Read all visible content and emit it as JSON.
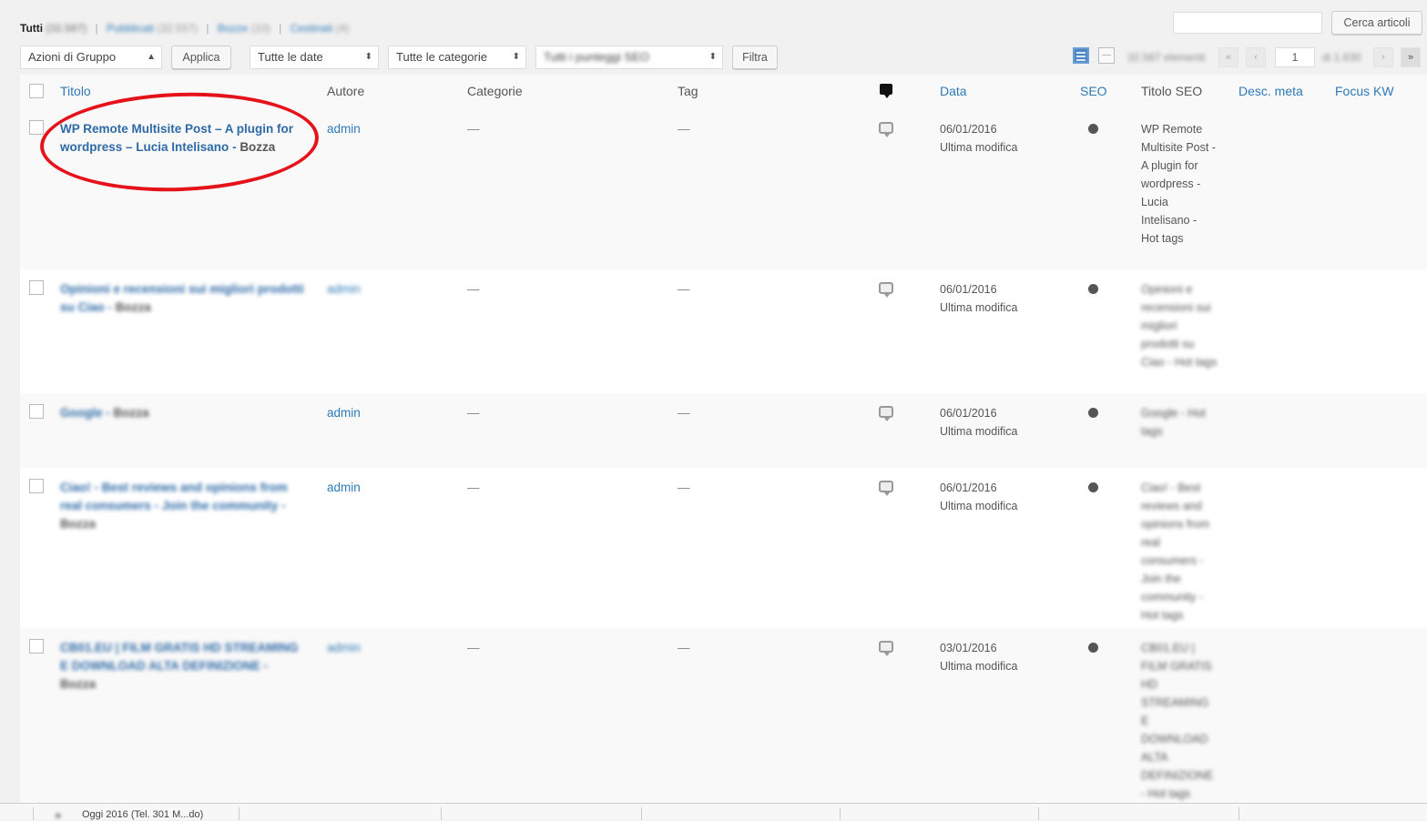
{
  "status_links": [
    {
      "label": "Tutti",
      "count": "(32.587)",
      "current": true
    },
    {
      "label": "Pubblicati",
      "count": "(32.557)",
      "current": false
    },
    {
      "label": "Bozze",
      "count": "(10)",
      "current": false
    },
    {
      "label": "Cestinati",
      "count": "(4)",
      "current": false
    }
  ],
  "search": {
    "button_label": "Cerca articoli",
    "value": ""
  },
  "toolbar": {
    "bulk_actions": "Azioni di Gruppo",
    "apply_label": "Applica",
    "date_filter": "Tutte le date",
    "category_filter": "Tutte le categorie",
    "seo_filter": "Tutti i punteggi SEO",
    "filter_label": "Filtra"
  },
  "pagination": {
    "items_count": "32.587 elementi",
    "first": "«",
    "prev": "‹",
    "current_page": "1",
    "total": "di 1.630",
    "next": "›",
    "last": "»"
  },
  "columns": {
    "title": "Titolo",
    "author": "Autore",
    "categories": "Categorie",
    "tags": "Tag",
    "date": "Data",
    "seo": "SEO",
    "seo_title": "Titolo SEO",
    "meta_desc": "Desc. meta",
    "focus_kw": "Focus KW"
  },
  "rows": [
    {
      "title": "WP Remote Multisite Post – A plugin for wordpress – Lucia Intelisano",
      "state": "Bozza",
      "author": "admin",
      "categories": "—",
      "tags": "—",
      "date": "06/01/2016",
      "date_note": "Ultima modifica",
      "seo_title": "WP Remote Multisite Post - A plugin for wordpress - Lucia Intelisano - Hot tags",
      "blurred": false
    },
    {
      "title": "Opinioni e recensioni sui migliori prodotti su Ciao",
      "state": "Bozza",
      "author": "admin",
      "categories": "—",
      "tags": "—",
      "date": "06/01/2016",
      "date_note": "Ultima modifica",
      "seo_title": "Opinioni e recensioni sui migliori prodotti su Ciao - Hot tags",
      "blurred": true
    },
    {
      "title": "Google",
      "state": "Bozza",
      "author": "admin",
      "categories": "—",
      "tags": "—",
      "date": "06/01/2016",
      "date_note": "Ultima modifica",
      "seo_title": "Google - Hot tags",
      "blurred": true
    },
    {
      "title": "Ciao! - Best reviews and opinions from real consumers - Join the community",
      "state": "Bozza",
      "author": "admin",
      "categories": "—",
      "tags": "—",
      "date": "06/01/2016",
      "date_note": "Ultima modifica",
      "seo_title": "Ciao! - Best reviews and opinions from real consumers - Join the community - Hot tags",
      "blurred": true
    },
    {
      "title": "CB01.EU | FILM GRATIS HD STREAMING E DOWNLOAD ALTA DEFINIZIONE",
      "state": "Bozza",
      "author": "admin",
      "categories": "—",
      "tags": "—",
      "date": "03/01/2016",
      "date_note": "Ultima modifica",
      "seo_title": "CB01.EU | FILM GRATIS HD STREAMING E DOWNLOAD ALTA DEFINIZIONE - Hot tags",
      "blurred": true
    }
  ],
  "bottom_bar": {
    "item": "Oggi 2016 (Tel. 301 M...do)"
  },
  "colors": {
    "link": "#2e7ab7",
    "annotation": "#e5121a",
    "background": "#f1f1f1"
  }
}
